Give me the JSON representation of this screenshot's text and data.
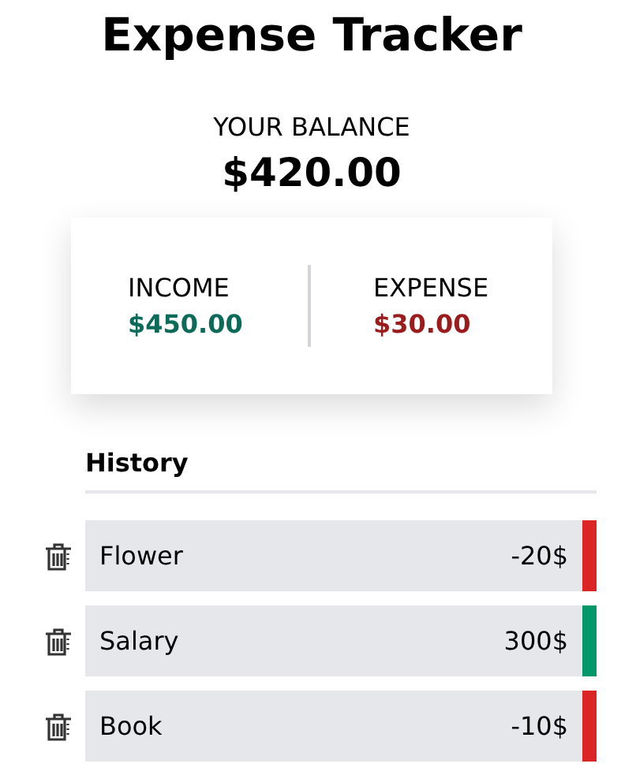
{
  "title": "Expense Tracker",
  "balance": {
    "label": "YOUR BALANCE",
    "amount": "$420.00"
  },
  "summary": [
    {
      "kind": "income",
      "label": "INCOME",
      "amount": "$450.00"
    },
    {
      "kind": "expense",
      "label": "EXPENSE",
      "amount": "$30.00"
    }
  ],
  "history": {
    "heading": "History",
    "items": [
      {
        "name": "Flower",
        "amount": "-20$",
        "color": "#dc2626"
      },
      {
        "name": "Salary",
        "amount": "300$",
        "color": "#059669"
      },
      {
        "name": "Book",
        "amount": "-10$",
        "color": "#dc2626"
      }
    ]
  }
}
